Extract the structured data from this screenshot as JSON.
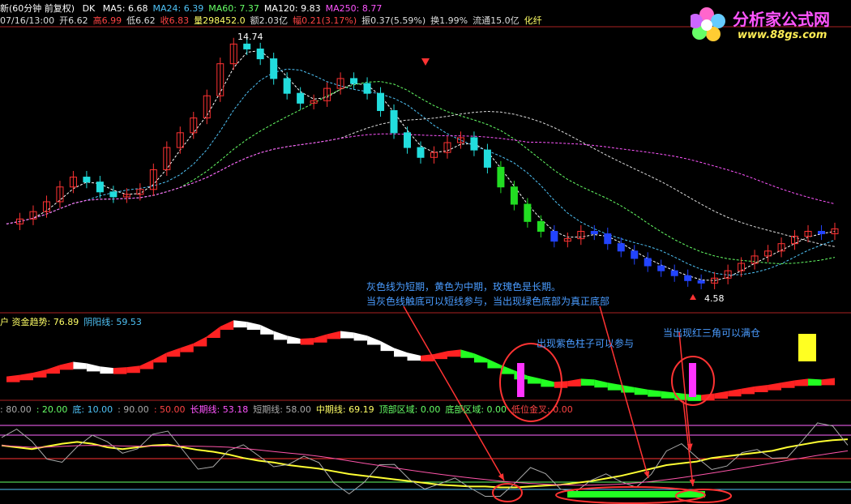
{
  "header": {
    "title": "新(60分钟 前复权)",
    "dk": "DK",
    "ma": [
      {
        "label": "MA5: 6.68",
        "color": "#ffffff"
      },
      {
        "label": "MA24: 6.39",
        "color": "#4fc3f7"
      },
      {
        "label": "MA60: 7.37",
        "color": "#66ff66"
      },
      {
        "label": "MA120: 9.83",
        "color": "#ffffff"
      },
      {
        "label": "MA250: 8.77",
        "color": "#ff55ff"
      }
    ],
    "quote": [
      {
        "label": "07/16/13:00",
        "color": "#dddddd"
      },
      {
        "label": "开6.62",
        "color": "#dddddd"
      },
      {
        "label": "高6.99",
        "color": "#ff4444"
      },
      {
        "label": "低6.62",
        "color": "#dddddd"
      },
      {
        "label": "收6.83",
        "color": "#ff4444"
      },
      {
        "label": "量298452.0",
        "color": "#ffff66"
      },
      {
        "label": "额2.03亿",
        "color": "#dddddd"
      },
      {
        "label": "幅0.21(3.17%)",
        "color": "#ff4444"
      },
      {
        "label": "振0.37(5.59%)",
        "color": "#dddddd"
      },
      {
        "label": "换1.99%",
        "color": "#dddddd"
      },
      {
        "label": "流通15.0亿",
        "color": "#dddddd"
      },
      {
        "label": "化纤",
        "color": "#ffff66"
      }
    ]
  },
  "panel2_header": [
    {
      "label": "户 资金趋势: 76.89",
      "color": "#ffff66"
    },
    {
      "label": "阴阳线: 59.53",
      "color": "#4fc3f7"
    }
  ],
  "panel3_header": [
    {
      "label": ": 80.00",
      "color": "#aaaaaa"
    },
    {
      "label": ": 20.00",
      "color": "#66ff66"
    },
    {
      "label": "底: 10.00",
      "color": "#4fc3f7"
    },
    {
      "label": ": 90.00",
      "color": "#aaaaaa"
    },
    {
      "label": ": 50.00",
      "color": "#ff4444"
    },
    {
      "label": "长期线: 53.18",
      "color": "#ff55ff"
    },
    {
      "label": "短期线: 58.00",
      "color": "#aaaaaa"
    },
    {
      "label": "中期线: 69.19",
      "color": "#ffff66"
    },
    {
      "label": "顶部区域: 0.00",
      "color": "#66ff66"
    },
    {
      "label": "底部区域: 0.00",
      "color": "#66ff66"
    },
    {
      "label": "低位金叉: 0.00",
      "color": "#ff4444"
    }
  ],
  "annotations": {
    "note1": "灰色线为短期，黄色为中期，玫瑰色是长期。",
    "note2": "当灰色线触底可以短线参与，当出现绿色底部为真正底部",
    "note3": "出现紫色柱子可以参与",
    "note4": "当出现红三角可以满仓"
  },
  "logo": {
    "name": "分析家公式网",
    "url": "www.88gs.com"
  },
  "chart_data": {
    "type": "candlestick",
    "high_label": "14.74",
    "low_label": "4.58",
    "trend_close": [
      7.1,
      7.3,
      7.6,
      8.0,
      8.6,
      9.0,
      8.8,
      8.4,
      8.2,
      8.3,
      8.5,
      9.3,
      10.2,
      10.8,
      11.4,
      12.3,
      13.6,
      14.4,
      14.2,
      13.8,
      13.0,
      12.4,
      12.0,
      12.1,
      12.6,
      13.0,
      12.8,
      12.4,
      11.7,
      10.8,
      10.2,
      9.8,
      10.0,
      10.4,
      10.6,
      10.1,
      9.4,
      8.6,
      7.9,
      7.2,
      6.8,
      6.4,
      6.5,
      6.8,
      6.7,
      6.3,
      6.0,
      5.7,
      5.4,
      5.2,
      5.0,
      4.8,
      4.7,
      4.9,
      5.2,
      5.5,
      5.8,
      6.0,
      6.3,
      6.6,
      6.8,
      6.7,
      6.9
    ],
    "osc_yellow": [
      62,
      60,
      58,
      61,
      64,
      66,
      64,
      60,
      58,
      60,
      62,
      63,
      60,
      57,
      55,
      52,
      48,
      45,
      43,
      40,
      38,
      36,
      33,
      30,
      28,
      26,
      24,
      22,
      20,
      18,
      17,
      16,
      16,
      15,
      15,
      16,
      17,
      18,
      20,
      22,
      25,
      28,
      32,
      36,
      40,
      42,
      44,
      48,
      50,
      52,
      54,
      56,
      60,
      63,
      66,
      68,
      69
    ]
  }
}
